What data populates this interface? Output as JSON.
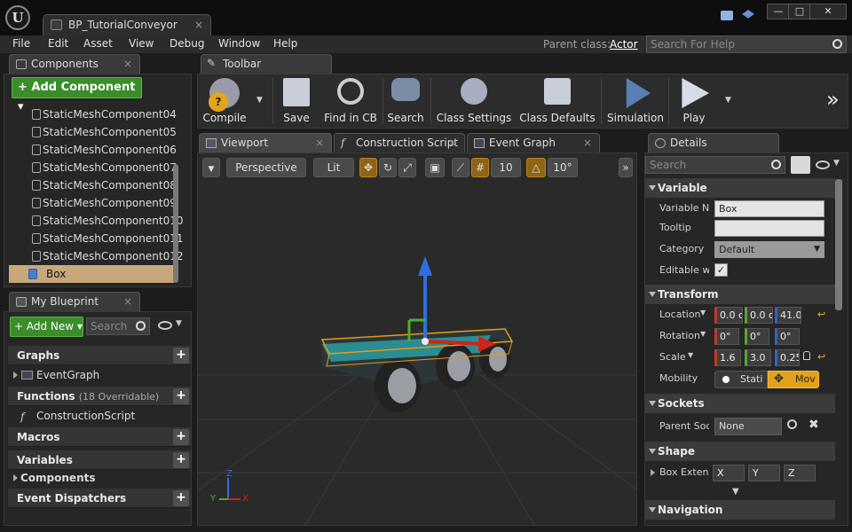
{
  "window": {
    "logo_text": "U",
    "doc_tab": "BP_TutorialConveyor",
    "tab_close": "×",
    "controls": {
      "minimize": "—",
      "maximize": "□",
      "close": "✕"
    }
  },
  "menu": {
    "items": [
      "File",
      "Edit",
      "Asset",
      "View",
      "Debug",
      "Window",
      "Help"
    ],
    "parent_class_label": "Parent class:",
    "parent_class_value": "Actor",
    "help_search_placeholder": "Search For Help"
  },
  "components": {
    "tab_label": "Components",
    "close": "×",
    "add_button": "+ Add Component ▾",
    "items": [
      {
        "label": "StaticMeshComponent04"
      },
      {
        "label": "StaticMeshComponent05"
      },
      {
        "label": "StaticMeshComponent06"
      },
      {
        "label": "StaticMeshComponent07"
      },
      {
        "label": "StaticMeshComponent08"
      },
      {
        "label": "StaticMeshComponent09"
      },
      {
        "label": "StaticMeshComponent010"
      },
      {
        "label": "StaticMeshComponent011"
      },
      {
        "label": "StaticMeshComponent012"
      },
      {
        "label": "Box"
      }
    ]
  },
  "toolbar": {
    "tab_label": "Toolbar",
    "buttons": [
      {
        "label": "Compile"
      },
      {
        "label": "Save"
      },
      {
        "label": "Find in CB"
      },
      {
        "label": "Search"
      },
      {
        "label": "Class Settings"
      },
      {
        "label": "Class Defaults"
      },
      {
        "label": "Simulation"
      },
      {
        "label": "Play"
      }
    ],
    "overflow": "»"
  },
  "editor_tabs": [
    {
      "label": "Viewport"
    },
    {
      "label": "Construction Script"
    },
    {
      "label": "Event Graph"
    }
  ],
  "viewport": {
    "perspective": "Perspective",
    "lit": "Lit",
    "grid_snap": "10",
    "rot_snap": "10°",
    "axis_x": "X",
    "axis_y": "Y",
    "axis_z": "Z"
  },
  "my_blueprint": {
    "tab_label": "My Blueprint",
    "add_new": "+ Add New ▾",
    "search_placeholder": "Search",
    "sections": {
      "graphs": "Graphs",
      "event_graph": "EventGraph",
      "functions": "Functions",
      "functions_note": "(18 Overridable)",
      "construction_script": "ConstructionScript",
      "macros": "Macros",
      "variables": "Variables",
      "components": "Components",
      "event_dispatchers": "Event Dispatchers"
    }
  },
  "details": {
    "tab_label": "Details",
    "search_placeholder": "Search",
    "sections": {
      "variable": "Variable",
      "transform": "Transform",
      "sockets": "Sockets",
      "shape": "Shape",
      "navigation": "Navigation"
    },
    "variable": {
      "name_label": "Variable Na",
      "name_value": "Box",
      "tooltip_label": "Tooltip",
      "tooltip_value": "",
      "category_label": "Category",
      "category_value": "Default",
      "editable_label": "Editable wh"
    },
    "transform": {
      "location_label": "Location",
      "location": [
        "0.0 c",
        "0.0 c",
        "41.0"
      ],
      "rotation_label": "Rotation",
      "rotation": [
        "0°",
        "0°",
        "0°"
      ],
      "scale_label": "Scale",
      "scale": [
        "1.6",
        "3.0",
        "0.25"
      ],
      "mobility_label": "Mobility",
      "mobility_static": "Stati",
      "mobility_movable": "Mov"
    },
    "sockets": {
      "parent_label": "Parent Soc",
      "parent_value": "None"
    },
    "shape": {
      "extent_label": "Box Extent",
      "x": "X",
      "y": "Y",
      "z": "Z"
    }
  },
  "colors": {
    "accent_green": "#3a8d2a",
    "selection": "#c8a87a",
    "active_toggle": "#8e6516"
  }
}
